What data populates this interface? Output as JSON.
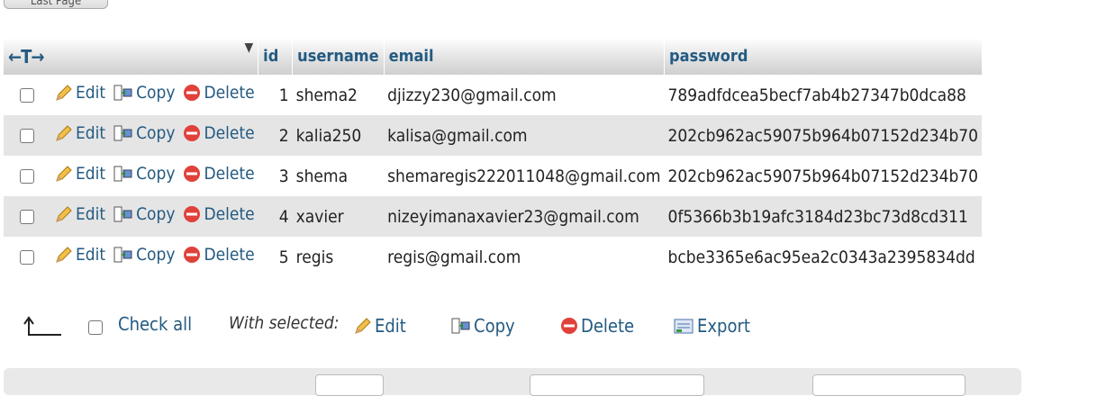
{
  "top_button": {
    "label": "Last Page"
  },
  "table": {
    "columns": [
      "id",
      "username",
      "email",
      "password"
    ],
    "action_labels": {
      "edit": "Edit",
      "copy": "Copy",
      "delete": "Delete"
    },
    "rows": [
      {
        "id": "1",
        "username": "shema2",
        "email": "djizzy230@gmail.com",
        "password": "789adfdcea5becf7ab4b27347b0dca88"
      },
      {
        "id": "2",
        "username": "kalia250",
        "email": "kalisa@gmail.com",
        "password": "202cb962ac59075b964b07152d234b70"
      },
      {
        "id": "3",
        "username": "shema",
        "email": "shemaregis222011048@gmail.com",
        "password": "202cb962ac59075b964b07152d234b70"
      },
      {
        "id": "4",
        "username": "xavier",
        "email": "nizeyimanaxavier23@gmail.com",
        "password": "0f5366b3b19afc3184d23bc73d8cd311"
      },
      {
        "id": "5",
        "username": "regis",
        "email": "regis@gmail.com",
        "password": "bcbe3365e6ac95ea2c0343a2395834dd"
      }
    ]
  },
  "bulk": {
    "check_all": "Check all",
    "with_selected": "With selected:",
    "edit": "Edit",
    "copy": "Copy",
    "delete": "Delete",
    "export": "Export"
  },
  "colors": {
    "link": "#235a81",
    "row_alt": "#e5e5e5",
    "delete_red": "#e0413a"
  }
}
